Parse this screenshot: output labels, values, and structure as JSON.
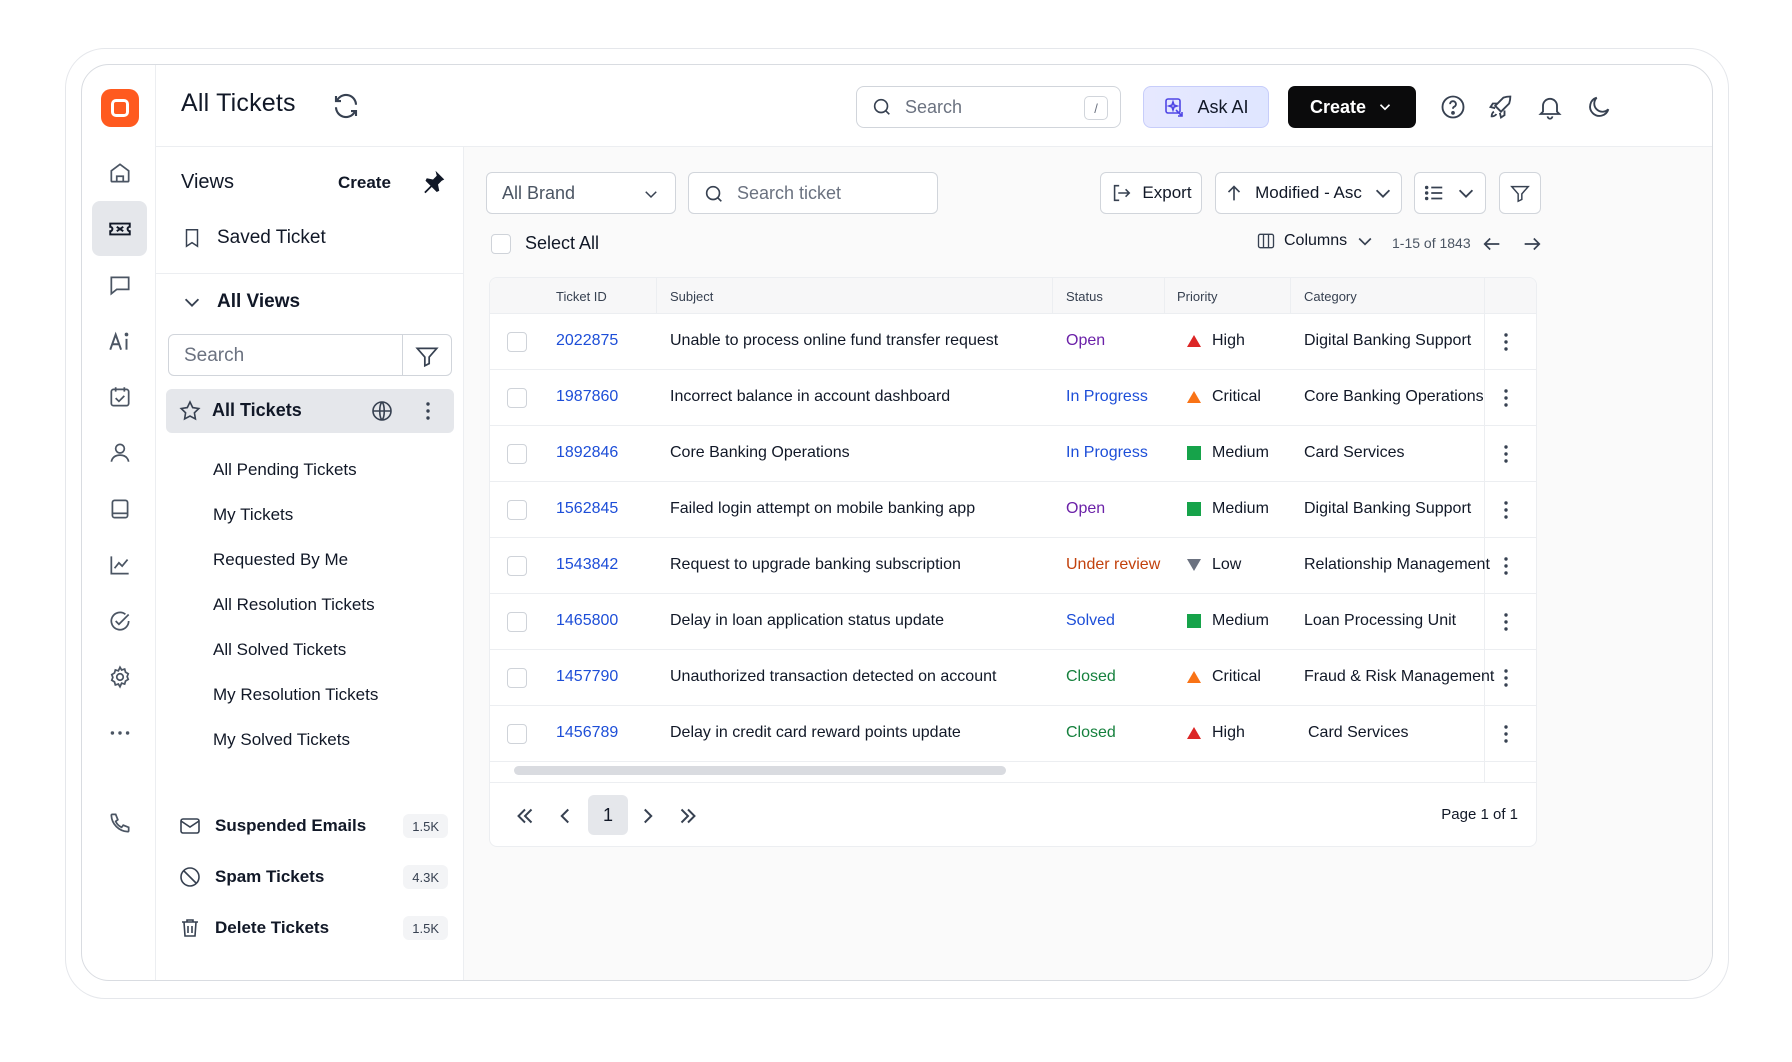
{
  "header": {
    "title": "All Tickets",
    "search_placeholder": "Search",
    "search_shortcut": "/",
    "ask_ai_label": "Ask AI",
    "create_label": "Create"
  },
  "views": {
    "title": "Views",
    "create_label": "Create",
    "saved_label": "Saved Ticket",
    "all_views_label": "All Views",
    "search_placeholder": "Search",
    "active_view": "All Tickets",
    "sub_views": [
      "All Pending Tickets",
      "My Tickets",
      "Requested By Me",
      "All Resolution Tickets",
      "All Solved Tickets",
      "My Resolution Tickets",
      "My Solved Tickets"
    ],
    "bottom": [
      {
        "label": "Suspended Emails",
        "count": "1.5K"
      },
      {
        "label": "Spam Tickets",
        "count": "4.3K"
      },
      {
        "label": "Delete Tickets",
        "count": "1.5K"
      }
    ]
  },
  "toolbar": {
    "brand_value": "All Brand",
    "search_placeholder": "Search ticket",
    "export_label": "Export",
    "sort_label": "Modified - Asc",
    "select_all_label": "Select All",
    "columns_label": "Columns",
    "range_label": "1-15 of 1843"
  },
  "table": {
    "headers": [
      "Ticket ID",
      "Subject",
      "Status",
      "Priority",
      "Category"
    ],
    "rows": [
      {
        "id": "2022875",
        "subject": "Unable to process online fund transfer request",
        "status": "Open",
        "priority": "High",
        "category": "Digital Banking Support"
      },
      {
        "id": "1987860",
        "subject": "Incorrect balance in account dashboard",
        "status": "In Progress",
        "priority": "Critical",
        "category": "Core Banking Operations"
      },
      {
        "id": "1892846",
        "subject": "Core Banking Operations",
        "status": "In Progress",
        "priority": "Medium",
        "category": "Card Services"
      },
      {
        "id": "1562845",
        "subject": "Failed login attempt on mobile banking app",
        "status": "Open",
        "priority": "Medium",
        "category": "Digital Banking Support"
      },
      {
        "id": "1543842",
        "subject": "Request to upgrade banking subscription",
        "status": "Under review",
        "priority": "Low",
        "category": "Relationship Management"
      },
      {
        "id": "1465800",
        "subject": "Delay in loan application status update",
        "status": "Solved",
        "priority": "Medium",
        "category": "Loan Processing Unit"
      },
      {
        "id": "1457790",
        "subject": "Unauthorized transaction detected on account",
        "status": "Closed",
        "priority": "Critical",
        "category": "Fraud & Risk Management"
      },
      {
        "id": "1456789",
        "subject": "Delay in credit card reward points update",
        "status": "Closed",
        "priority": "High",
        "category": "Card Services"
      }
    ]
  },
  "pager": {
    "current_page": "1",
    "page_info": "Page 1 of 1"
  },
  "colors": {
    "status": {
      "Open": "#6b21a8",
      "In Progress": "#1d4ed8",
      "Under review": "#c2410c",
      "Solved": "#1d4ed8",
      "Closed": "#15803d"
    },
    "priority": {
      "High": "#dc2626",
      "Critical": "#f97316",
      "Medium": "#16a34a",
      "Low": "#6b7280"
    },
    "brand": "#ff5a1f"
  }
}
